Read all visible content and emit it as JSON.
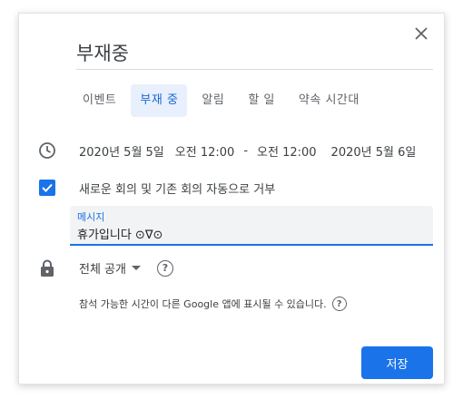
{
  "dialog": {
    "title": "부재중",
    "tabs": [
      {
        "label": "이벤트"
      },
      {
        "label": "부재 중"
      },
      {
        "label": "알림"
      },
      {
        "label": "할 일"
      },
      {
        "label": "약속 시간대"
      }
    ],
    "active_tab": "부재 중",
    "date_range": {
      "start_date": "2020년 5월 5일",
      "start_time": "오전 12:00",
      "separator": "-",
      "end_time": "오전 12:00",
      "end_date": "2020년 5월 6일"
    },
    "decline_checkbox": {
      "label": "새로운 회의 및 기존 회의 자동으로 거부",
      "checked": true
    },
    "message": {
      "label": "메시지",
      "value": "휴가입니다 ⊙∇⊙"
    },
    "visibility": {
      "label": "전체 공개"
    },
    "notice": "참석 가능한 시간이 다른 Google 앱에 표시될 수 있습니다.",
    "save_label": "저장"
  },
  "colors": {
    "accent": "#1a73e8",
    "tab_active_bg": "#e8f0fe",
    "field_bg": "#f1f3f4"
  },
  "icons": [
    "close-icon",
    "clock-icon",
    "checkbox-checked-icon",
    "lock-icon",
    "caret-down-icon",
    "help-icon"
  ]
}
